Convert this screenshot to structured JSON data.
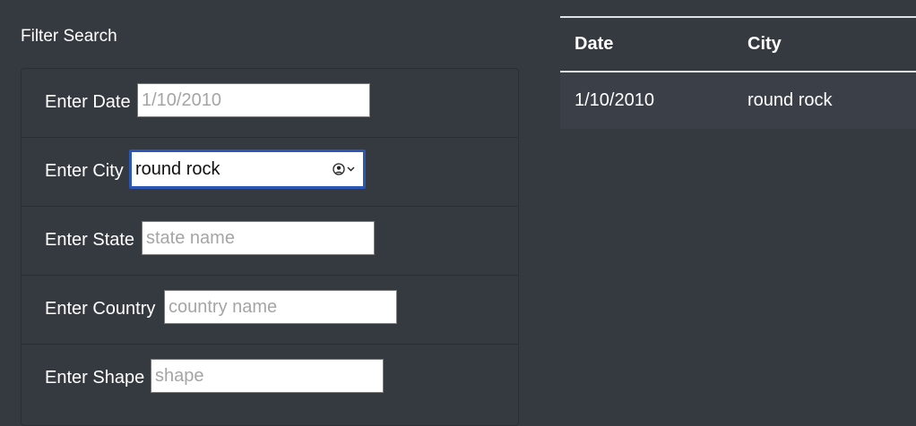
{
  "filter": {
    "title": "Filter Search",
    "fields": [
      {
        "label": "Enter Date",
        "value": "",
        "placeholder": "1/10/2010"
      },
      {
        "label": "Enter City",
        "value": "round rock",
        "placeholder": ""
      },
      {
        "label": "Enter State",
        "value": "",
        "placeholder": "state name"
      },
      {
        "label": "Enter Country",
        "value": "",
        "placeholder": "country name"
      },
      {
        "label": "Enter Shape",
        "value": "",
        "placeholder": "shape"
      }
    ],
    "city_icon": "contact-autofill-icon"
  },
  "table": {
    "columns": [
      "Date",
      "City"
    ],
    "rows": [
      [
        "1/10/2010",
        "round rock"
      ]
    ]
  },
  "colors": {
    "background": "#353a41",
    "focus_border": "#2c56b5",
    "row_background": "#3b4048"
  }
}
